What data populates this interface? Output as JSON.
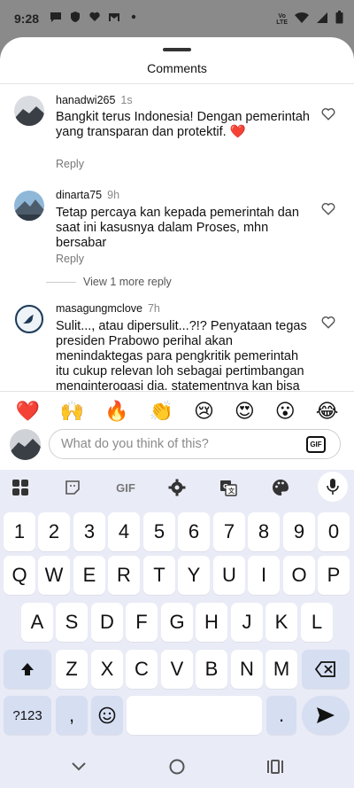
{
  "status_bar": {
    "time": "9:28",
    "network_label": "VoLTE"
  },
  "sheet": {
    "title": "Comments"
  },
  "comments": [
    {
      "username": "hanadwi265",
      "time": "1s",
      "text": "Bangkit terus Indonesia! Dengan pemerintah yang transparan dan protektif. ❤️",
      "reply_label": "Reply"
    },
    {
      "username": "dinarta75",
      "time": "9h",
      "text": "Tetap percaya kan kepada pemerintah dan saat ini kasusnya dalam Proses, mhn bersabar",
      "reply_label": "Reply",
      "more_replies_label": "View 1 more reply"
    },
    {
      "username": "masagungmclove",
      "time": "7h",
      "text": "Sulit..., atau dipersulit...?!? Penyataan tegas presiden Prabowo perihal akan menindaktegas para pengkritik pemerintah itu cukup relevan loh sebagai pertimbangan menginterogasi dia, statementnya kan bisa dijadikan ..."
    }
  ],
  "emoji_bar": [
    "❤️",
    "🙌",
    "🔥",
    "👏",
    "😢",
    "😍",
    "😮",
    "😂"
  ],
  "input": {
    "placeholder": "What do you think of this?",
    "gif_label": "GIF"
  },
  "keyboard": {
    "toolbar": {
      "gif_label": "GIF"
    },
    "rows": [
      [
        "1",
        "2",
        "3",
        "4",
        "5",
        "6",
        "7",
        "8",
        "9",
        "0"
      ],
      [
        "Q",
        "W",
        "E",
        "R",
        "T",
        "Y",
        "U",
        "I",
        "O",
        "P"
      ],
      [
        "A",
        "S",
        "D",
        "F",
        "G",
        "H",
        "J",
        "K",
        "L"
      ],
      [
        "Z",
        "X",
        "C",
        "V",
        "B",
        "N",
        "M"
      ]
    ],
    "symbols_label": "?123",
    "comma_label": ",",
    "period_label": "."
  }
}
